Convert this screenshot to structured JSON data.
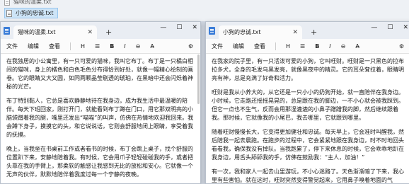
{
  "explorer": {
    "files": [
      "猫咪的温柔.txt",
      "小狗的忠诚.txt"
    ]
  },
  "windows": [
    {
      "tab_title": "猫咪的温柔.txt",
      "close_glyph": "✕",
      "add_glyph": "+",
      "caption": {
        "minimize": "—",
        "maximize": "☐",
        "close": "✕"
      },
      "menu": {
        "file": "文件",
        "edit": "编辑",
        "view": "查看",
        "heading": "H",
        "list": "☰",
        "bold": "B",
        "italic": "I",
        "link": "⊖",
        "clear": "A̶",
        "settings": "⚙"
      },
      "paragraphs": [
        "在我独居的小公寓里，有一只可爱的猫咪，我叫它布丁。布丁是一只橘白相间的猫咪，身上的橘色和白色毛色分布得恰到好处，就像一幅精心绘制的画卷。它的眼睛又大又圆，如同两颗晶莹剔透的琥珀，在黑暗中还会闪烁着神秘的光芒。",
        "布丁特别黏人，它总是喜欢静静地待在我身边，成为我生活中最温暖的陪伴。每天下班回家，刚打开门，就能看到布丁蹲在门口，用它那双明亮的小脑袋蹭着我的腿，嘴里还发出“喵喵”的叫声，仿佛在热情地欢迎我回来。我会蹲下身子，摸摸它的头，和它说说话，它则会舒服地闭上眼睛，享受着我的抚摸。",
        "晚上，当我坐在书桌前工作或者看书的时候，布丁会跳上桌子，找个舒服的位置趴下来，安静地陪着我。有时候，它会用爪子轻轻碰碰我的手，或者把头靠在我的手臂上，那柔软的触感让我感到无比的放松和安心。它就像一个无声的伙伴，默默地陪伴着我度过每一个宁静的夜晚。"
      ]
    },
    {
      "tab_title": "小狗的忠诚.txt",
      "close_glyph": "✕",
      "add_glyph": "+",
      "caption": {
        "minimize": "—",
        "maximize": "☐",
        "close": "✕"
      },
      "menu": {
        "file": "文件",
        "edit": "编辑",
        "view": "查看",
        "heading": "H",
        "list": "☰",
        "bold": "B",
        "italic": "I",
        "link": "⊖",
        "clear": "A̶",
        "settings": "⚙"
      },
      "paragraphs": [
        "在我家的院子里，有一只活泼可爱的小狗，它叫旺财。旺财是一只黑色的拉布拉多犬，全身的毛发乌黑发亮，就像黑夜中的精灵。它的耳朵耷拉着，眼睛明亮有神，总是充满了好奇和活力。",
        "旺财是我从小养大的，从它还是一只小小的奶狗开始，就一直陪伴在我身边。小时候，它走路还摇摇晃晃的，总是跟在我的脚边，一不小心就会被我踩到。但它一点也不生气，反而会用那湿漉漉的小鼻子蹭蹭我的脚，然后继续跟着我。那时候，它就像我的小尾巴，我去哪里，它就跟到哪里。",
        "随着旺财慢慢长大，它变得更加健壮和忠诚。每天早上，它会准时叫醒我，然后陪我一起去晨跑。在跑步的过程中，它会紧紧地跟在我身边，时不时地回头看看我，确保我没有掉队。当我跑累了，停下来休息的时候，它会乖乖地趴在我身边，用舌头舔舔我的手，仿佛在鼓励我：“主人，加油！”",
        "有一次，我和家人一起去山里游玩，不小心迷路了。天色渐渐暗了下来，我心里有些害怕。就在这时，旺财突然变得警觉起来，它用鼻子嗅着地面的气"
      ]
    }
  ]
}
